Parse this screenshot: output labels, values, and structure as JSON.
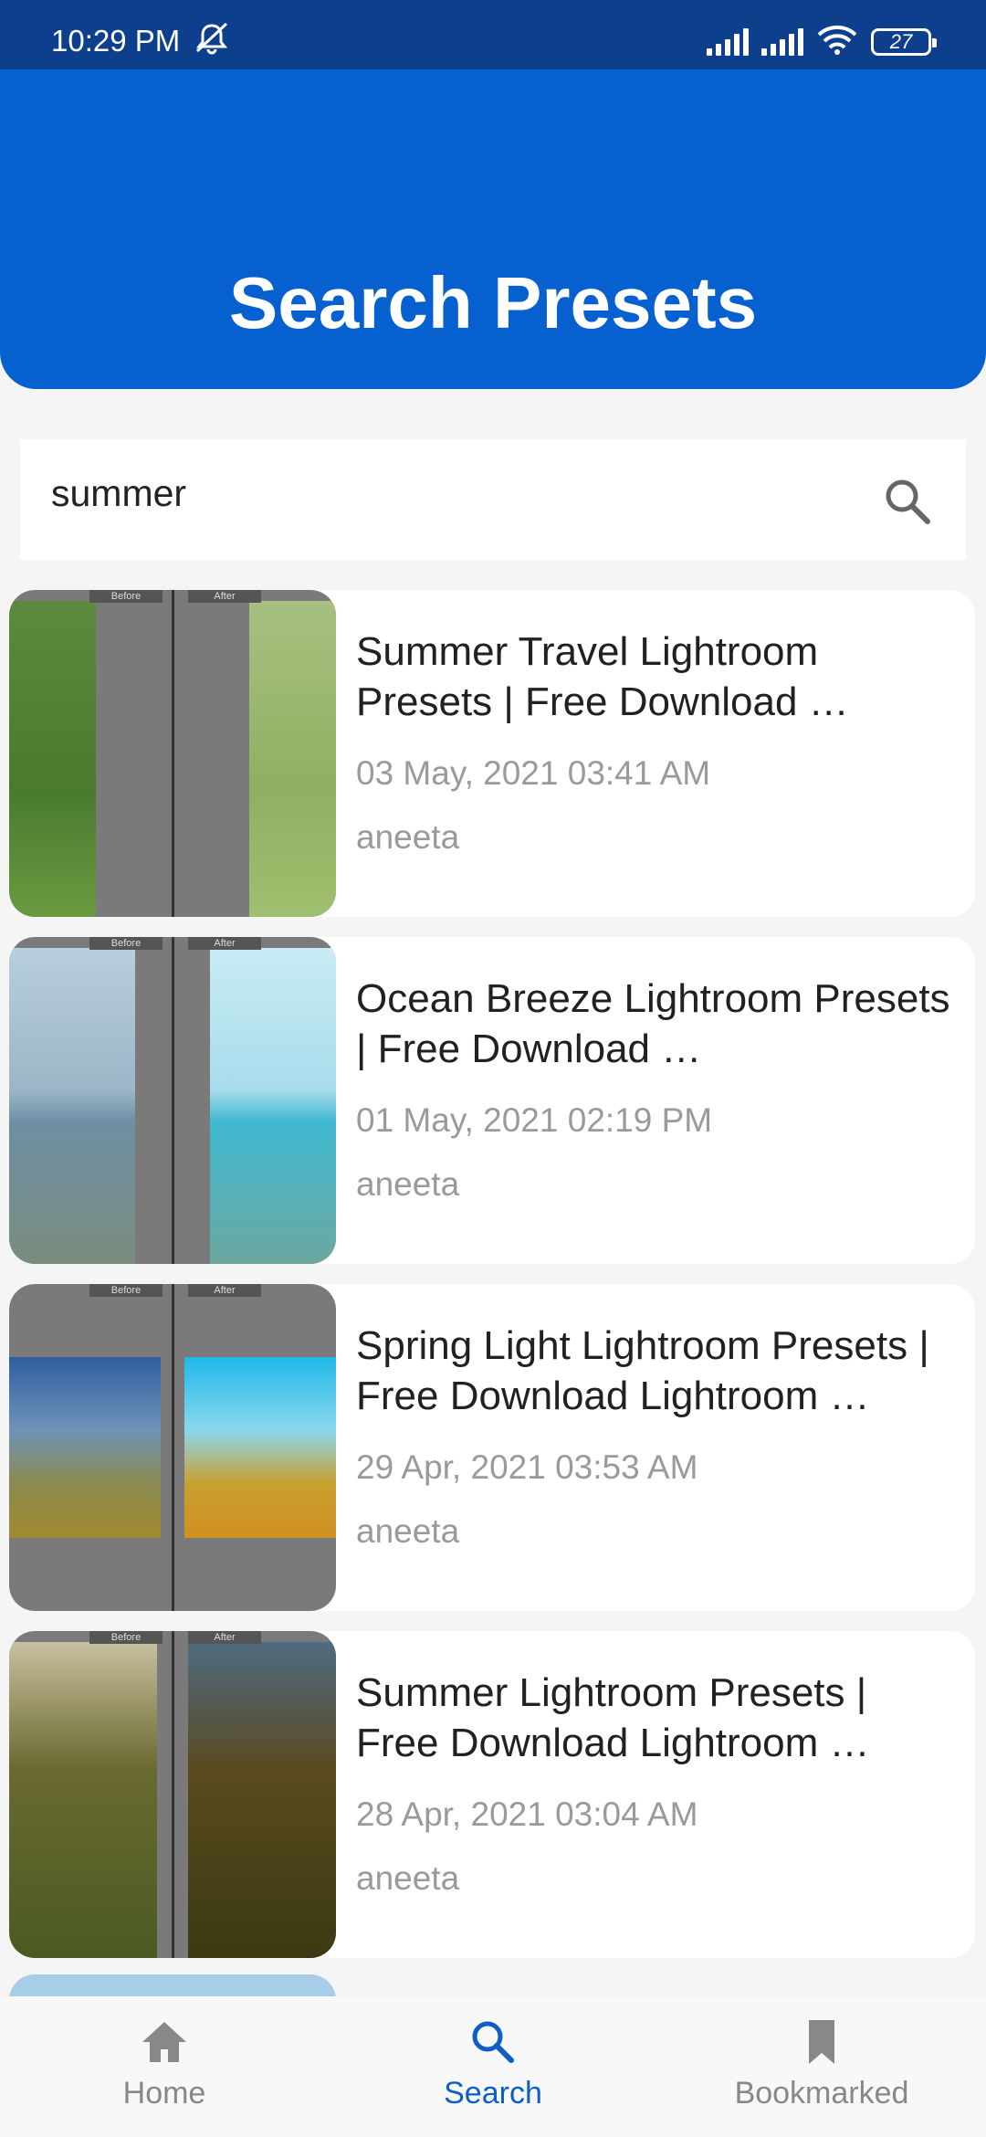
{
  "status_bar": {
    "time": "10:29 PM",
    "battery": "27",
    "icons": [
      "silent-icon",
      "signal-icon",
      "signal-icon",
      "wifi-icon",
      "battery-icon"
    ]
  },
  "header": {
    "title": "Search Presets",
    "bg_color": "#0660d0"
  },
  "search": {
    "value": "summer",
    "icon": "search-icon"
  },
  "results": [
    {
      "title": "Summer Travel Lightroom Presets | Free Download …",
      "date": "03 May, 2021 03:41 AM",
      "author": "aneeta",
      "thumb_labels": [
        "Before",
        "After"
      ]
    },
    {
      "title": "Ocean Breeze Lightroom Presets | Free Download …",
      "date": "01 May, 2021 02:19 PM",
      "author": "aneeta",
      "thumb_labels": [
        "Before",
        "After"
      ]
    },
    {
      "title": "Spring Light Lightroom Presets | Free Download Lightroom …",
      "date": "29 Apr, 2021 03:53 AM",
      "author": "aneeta",
      "thumb_labels": [
        "Before",
        "After"
      ]
    },
    {
      "title": "Summer Lightroom Presets | Free Download Lightroom …",
      "date": "28 Apr, 2021 03:04 AM",
      "author": "aneeta",
      "thumb_labels": [
        "Before",
        "After"
      ]
    }
  ],
  "bottom_nav": {
    "items": [
      {
        "label": "Home",
        "icon": "home-icon",
        "active": false
      },
      {
        "label": "Search",
        "icon": "search-icon",
        "active": true
      },
      {
        "label": "Bookmarked",
        "icon": "bookmark-icon",
        "active": false
      }
    ],
    "active_color": "#0d5fc7"
  }
}
